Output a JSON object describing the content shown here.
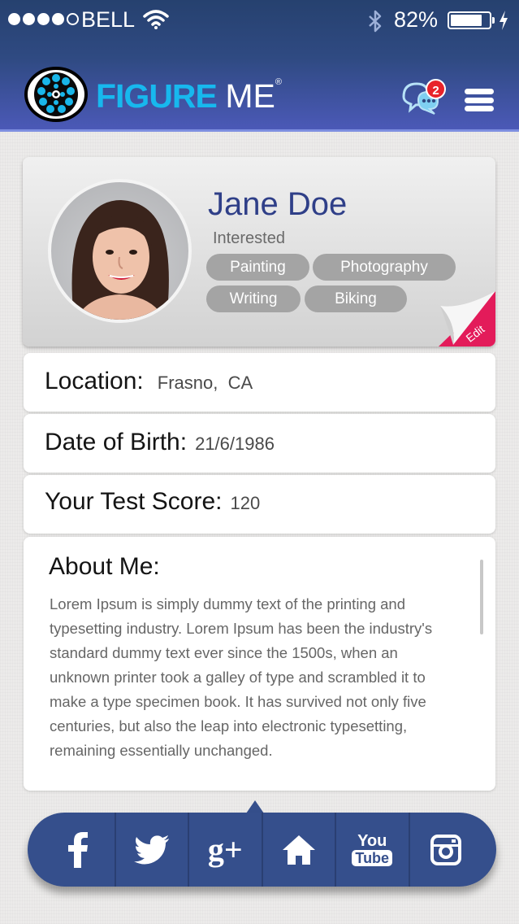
{
  "status_bar": {
    "carrier": "BELL",
    "battery_percent": "82%",
    "battery_level": 0.82,
    "signal_bars_filled": 4,
    "signal_bars_total": 5
  },
  "header": {
    "brand_part1": "FIGURE",
    "brand_part2": "ME",
    "brand_mark": "®",
    "notification_count": "2"
  },
  "profile": {
    "name": "Jane Doe",
    "interested_label": "Interested",
    "interests": [
      "Painting",
      "Photography",
      "Writing",
      "Biking"
    ],
    "edit_label": "Edit"
  },
  "details": {
    "location": {
      "label": "Location:",
      "value": "Frasno,  CA"
    },
    "dob": {
      "label": "Date of Birth:",
      "value": "21/6/1986"
    },
    "score": {
      "label": "Your Test Score:",
      "value": "120"
    }
  },
  "about": {
    "title": "About Me:",
    "text": "Lorem Ipsum is simply dummy text of the printing and typesetting industry. Lorem Ipsum has been the industry's standard dummy text ever since the 1500s, when an unknown printer took a galley of type and scrambled it to make a type specimen book. It has survived not only five centuries, but also the leap into electronic typesetting, remaining essentially unchanged."
  },
  "social": {
    "items": [
      "facebook-icon",
      "twitter-icon",
      "google-plus-icon",
      "home-icon",
      "youtube-icon",
      "instagram-icon"
    ],
    "google_plus_text": "g+",
    "youtube_you": "You",
    "youtube_tube": "Tube"
  },
  "colors": {
    "header_top": "#26416f",
    "header_bottom": "#4b59b7",
    "brand_cyan": "#17b8ee",
    "name_blue": "#2f3f88",
    "badge_red": "#e8232a",
    "edit_pink": "#e31b5a",
    "social_bar": "#354f8c"
  }
}
